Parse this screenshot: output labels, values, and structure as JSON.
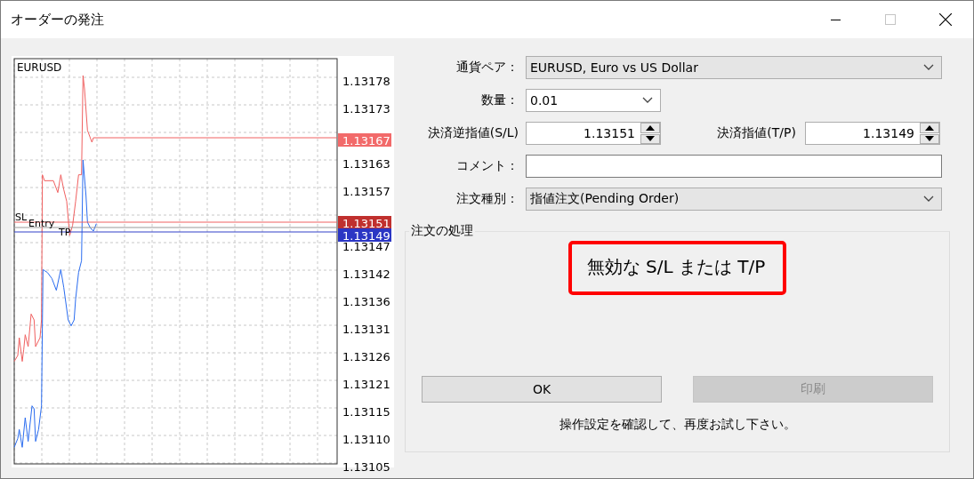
{
  "window": {
    "title": "オーダーの発注"
  },
  "chart": {
    "symbol": "EURUSD",
    "axis_labels": [
      "1.13178",
      "1.13173",
      "1.13163",
      "1.13157",
      "1.13147",
      "1.13142",
      "1.13136",
      "1.13131",
      "1.13126",
      "1.13121",
      "1.13115",
      "1.13110",
      "1.13105"
    ],
    "line_labels": [
      "SL",
      "Entry",
      "TP"
    ],
    "price_tags": [
      {
        "text": "1.13167",
        "color": "#f26a6a"
      },
      {
        "text": "1.13151",
        "color": "#c0302e"
      },
      {
        "text": "1.13149",
        "color": "#2b36c4"
      }
    ]
  },
  "form": [
    {
      "kind": "select",
      "label": "通貨ペア：",
      "value": "EURUSD, Euro vs US Dollar"
    },
    {
      "kind": "combo",
      "label": "数量：",
      "value": "0.01"
    },
    {
      "kind": "spinpair",
      "label": "決済逆指値(S/L)",
      "value": "1.13151",
      "label2": "決済指値(T/P)",
      "value2": "1.13149"
    },
    {
      "kind": "text",
      "label": "コメント："
    },
    {
      "kind": "select",
      "label": "注文種別：",
      "value": "指値注文(Pending Order)"
    }
  ],
  "processing": {
    "legend": "注文の処理",
    "message": "無効な S/L または T/P",
    "buttons": [
      {
        "label": "OK",
        "disabled": false
      },
      {
        "label": "印刷",
        "disabled": true
      }
    ],
    "note": "操作設定を確認して、再度お試し下さい。"
  }
}
